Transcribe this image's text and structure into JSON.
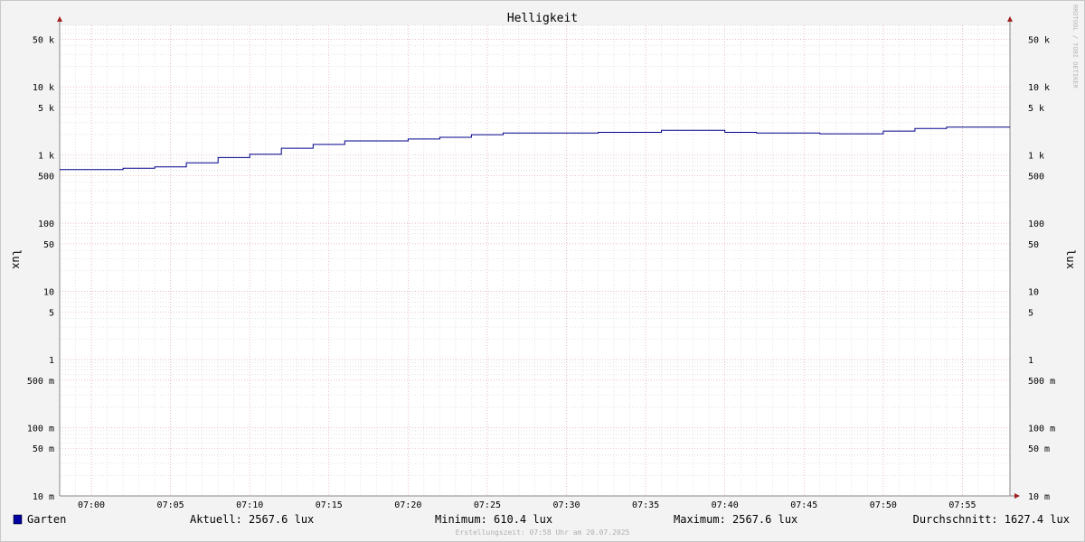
{
  "watermark": "RRDTOOL / TOBI OETIKER",
  "footer": "Erstellungszeit: 07:58 Uhr am 20.07.2025",
  "colors": {
    "series": "#00008b",
    "legend_swatch": "#0000a0",
    "major_grid": "#e8a0a8",
    "minor_grid": "#c8c8c8",
    "axis": "#888888",
    "arrow": "#a02020",
    "canvas": "#ffffff",
    "background": "#f3f3f3"
  },
  "legend": {
    "series_name": "Garten",
    "current": "Aktuell: 2567.6 lux",
    "minimum": "Minimum: 610.4 lux",
    "maximum": "Maximum: 2567.6 lux",
    "average": "Durchschnitt: 1627.4 lux"
  },
  "chart_data": {
    "type": "line",
    "title": "Helligkeit",
    "ylabel": "lux",
    "yscale": "log",
    "grid": true,
    "ylim": [
      0.01,
      80000
    ],
    "xlim": [
      "06:58",
      "07:58"
    ],
    "y_tick_values": [
      50000,
      10000,
      5000,
      1000,
      500,
      100,
      50,
      10,
      5,
      1,
      0.5,
      0.1,
      0.05,
      0.01
    ],
    "y_tick_labels": [
      "50 k",
      "10 k",
      "5 k",
      "1 k",
      "500",
      "100",
      "50",
      "10",
      "5",
      "1",
      "500 m",
      "100 m",
      "50 m",
      "10 m"
    ],
    "x_tick_labels": [
      "07:00",
      "07:05",
      "07:10",
      "07:15",
      "07:20",
      "07:25",
      "07:30",
      "07:35",
      "07:40",
      "07:45",
      "07:50",
      "07:55"
    ],
    "series": [
      {
        "name": "Garten",
        "x": [
          "06:58",
          "07:02",
          "07:04",
          "07:06",
          "07:08",
          "07:10",
          "07:12",
          "07:14",
          "07:16",
          "07:18",
          "07:20",
          "07:22",
          "07:24",
          "07:26",
          "07:28",
          "07:30",
          "07:32",
          "07:34",
          "07:36",
          "07:38",
          "07:40",
          "07:42",
          "07:44",
          "07:46",
          "07:48",
          "07:50",
          "07:52",
          "07:54",
          "07:56",
          "07:58"
        ],
        "values": [
          610,
          640,
          670,
          770,
          920,
          1030,
          1260,
          1430,
          1610,
          1610,
          1720,
          1820,
          1990,
          2100,
          2100,
          2100,
          2150,
          2150,
          2300,
          2300,
          2150,
          2100,
          2100,
          2050,
          2050,
          2250,
          2450,
          2567.6,
          2567.6,
          2567.6
        ]
      }
    ]
  }
}
